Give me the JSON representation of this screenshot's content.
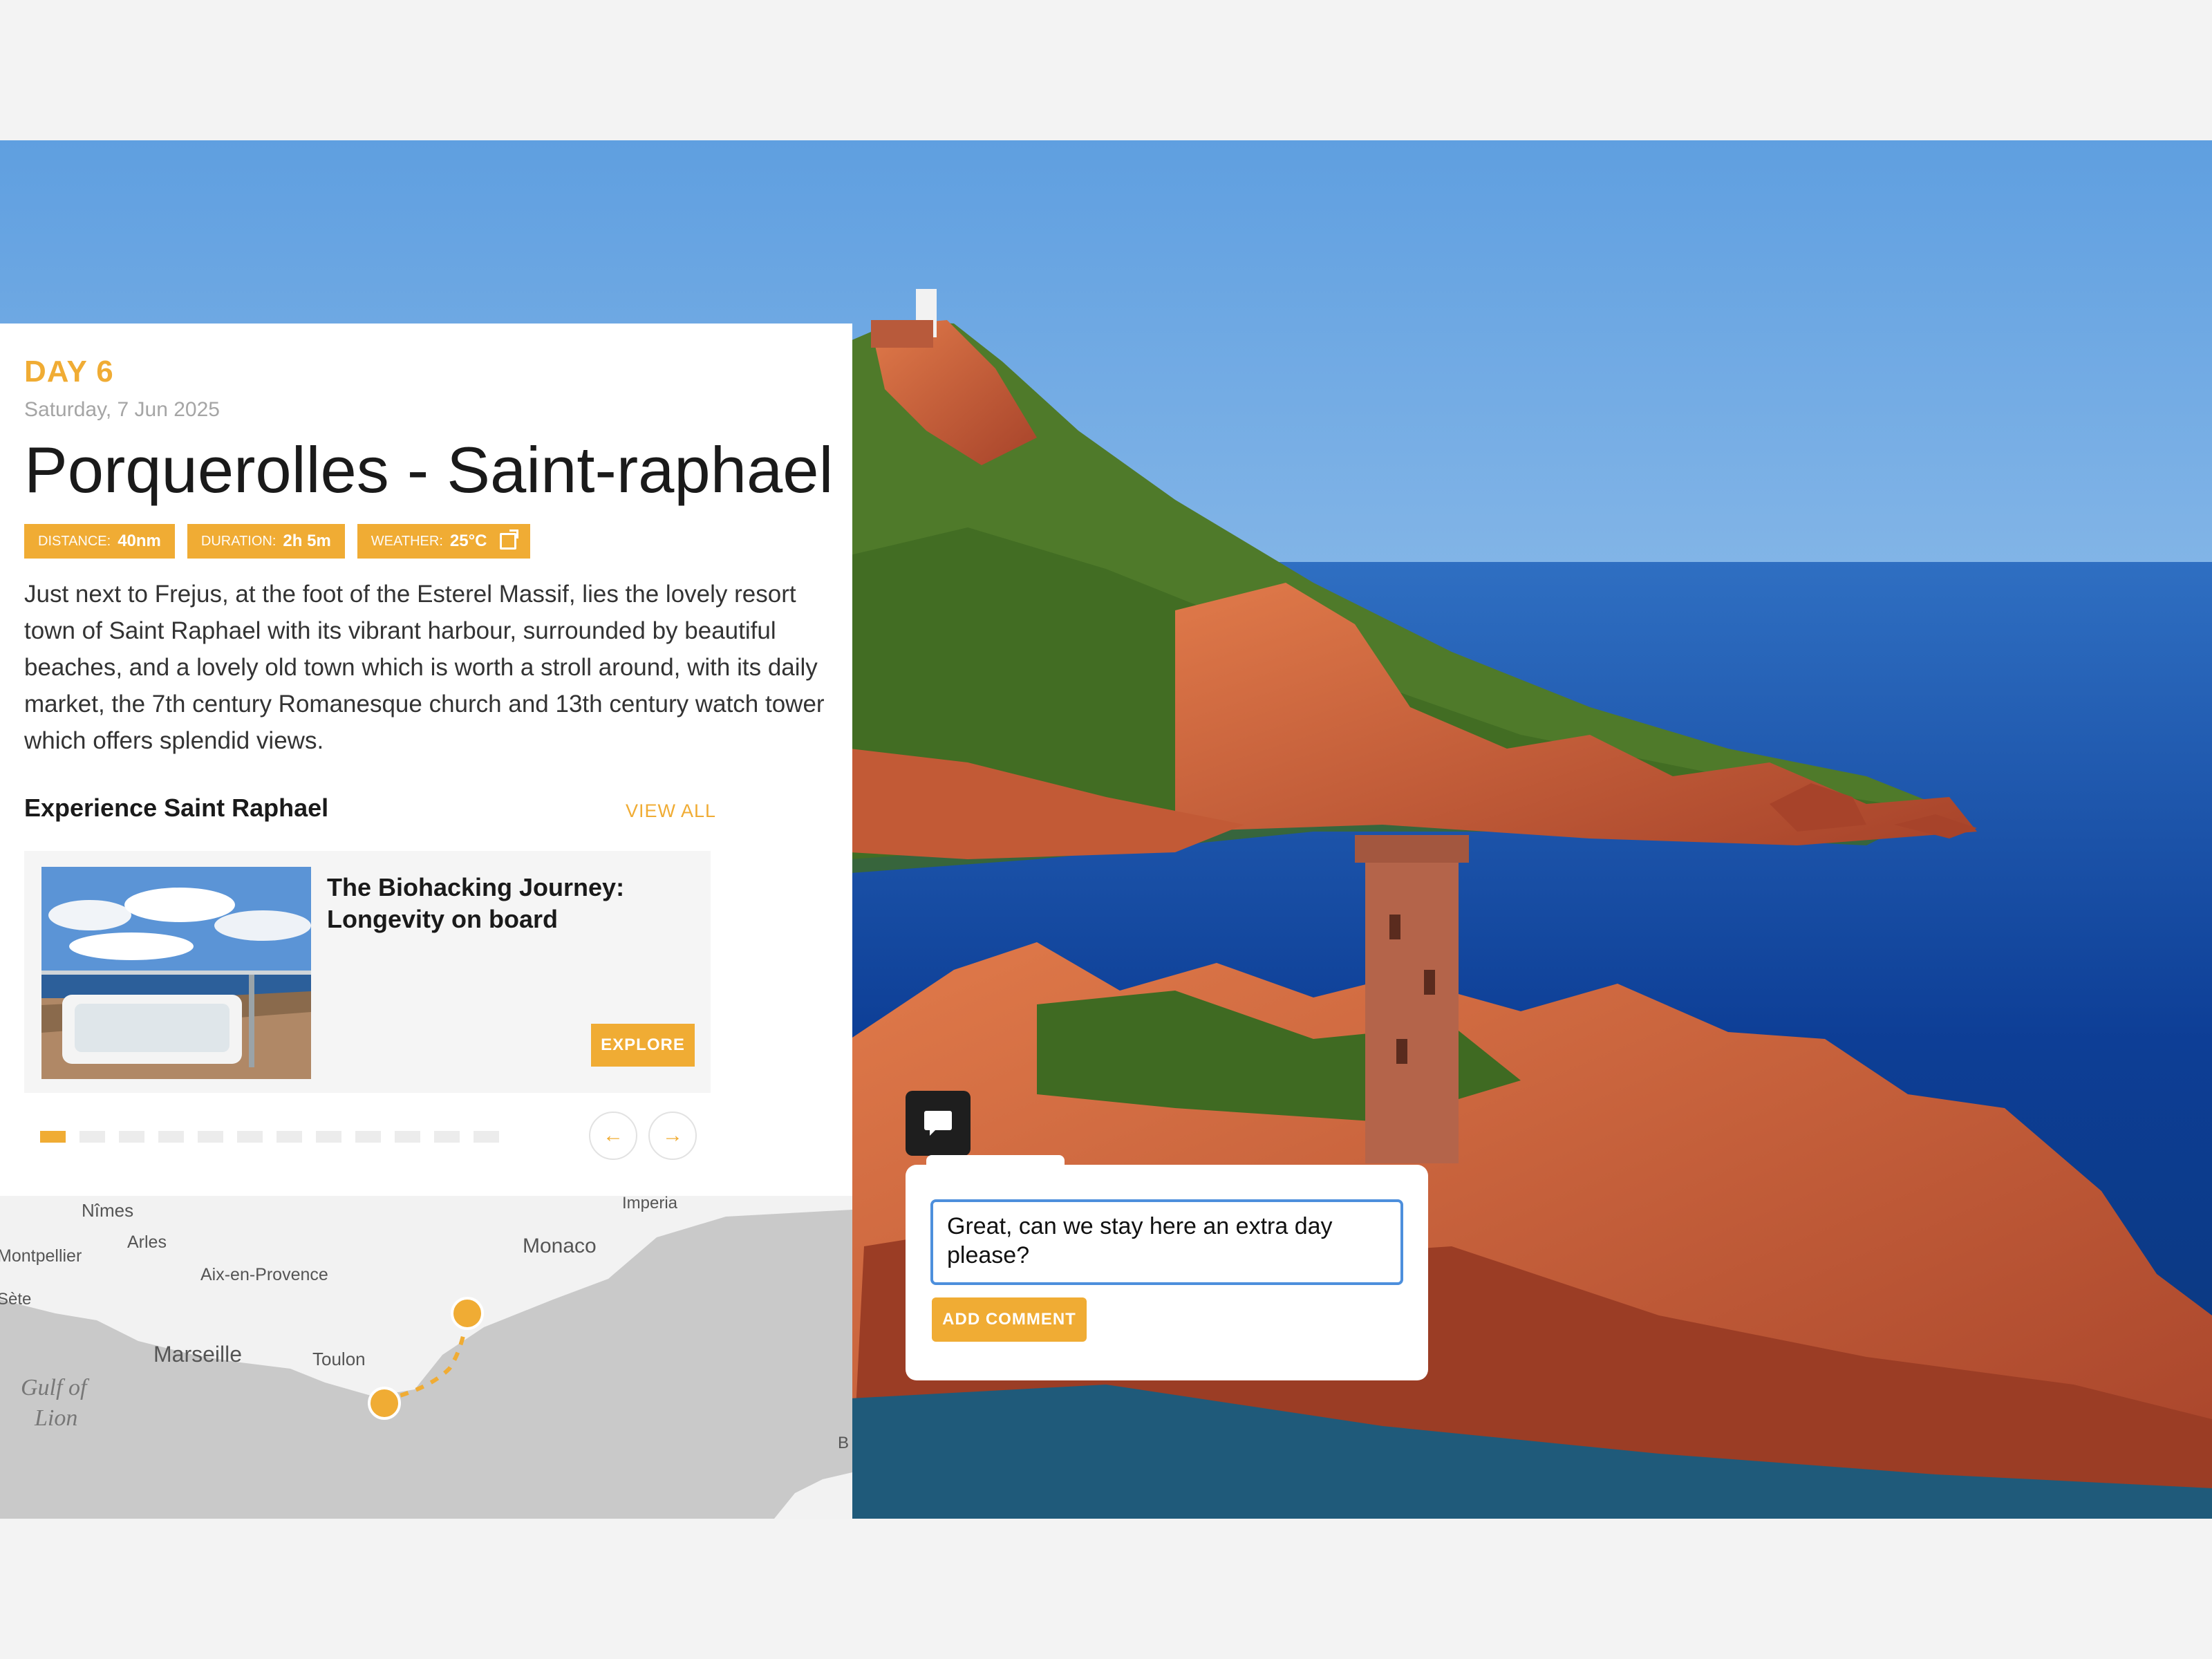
{
  "day": {
    "label": "DAY 6",
    "date": "Saturday, 7 Jun 2025",
    "title": "Porquerolles - Saint-raphael",
    "badges": [
      {
        "key": "DISTANCE:",
        "value": "40nm"
      },
      {
        "key": "DURATION:",
        "value": "2h 5m"
      },
      {
        "key": "WEATHER:",
        "value": "25°C"
      }
    ],
    "description": "Just next to Frejus, at the foot of the Esterel Massif, lies the lovely resort town of Saint Raphael with its vibrant harbour, surrounded by beautiful beaches, and a lovely old town which is worth a stroll around, with its daily market, the 7th century Romanesque church and 13th century watch tower which offers splendid views."
  },
  "experience": {
    "heading": "Experience Saint Raphael",
    "view_all": "VIEW ALL",
    "card": {
      "title": "The Biohacking Journey: Longevity on board",
      "button": "EXPLORE"
    },
    "carousel": {
      "total": 12,
      "active": 0
    },
    "prev_icon": "←",
    "next_icon": "→"
  },
  "map": {
    "labels": [
      "Nîmes",
      "Arles",
      "Montpellier",
      "Sète",
      "Aix-en-Provence",
      "Marseille",
      "Toulon",
      "Monaco",
      "Imperia",
      "Gulf of",
      "Lion",
      "B"
    ]
  },
  "comment": {
    "toggle_icon": "comment-icon",
    "text": "Great, can we stay here an extra day please?",
    "button": "ADD COMMENT"
  },
  "colors": {
    "accent": "#f0ac34",
    "focus": "#4d8fdc"
  }
}
